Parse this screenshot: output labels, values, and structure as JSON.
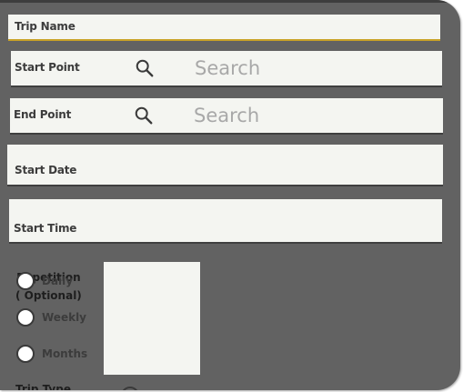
{
  "form": {
    "trip_name_label": "Trip Name",
    "start_point": {
      "label": "Start Point",
      "placeholder": "Search"
    },
    "end_point": {
      "label": "End Point",
      "placeholder": "Search"
    },
    "start_date_label": "Start Date",
    "start_time_label": "Start Time",
    "repetition": {
      "label": "Repetition\n( Optional)",
      "options": [
        "Daily",
        "Weekly",
        "Months"
      ]
    },
    "trip_type_label": "Trip Type"
  },
  "colors": {
    "background": "#626262",
    "field_background": "#f4f5f1",
    "accent_underline": "#c9a227",
    "placeholder_text": "#a8a8a8"
  }
}
